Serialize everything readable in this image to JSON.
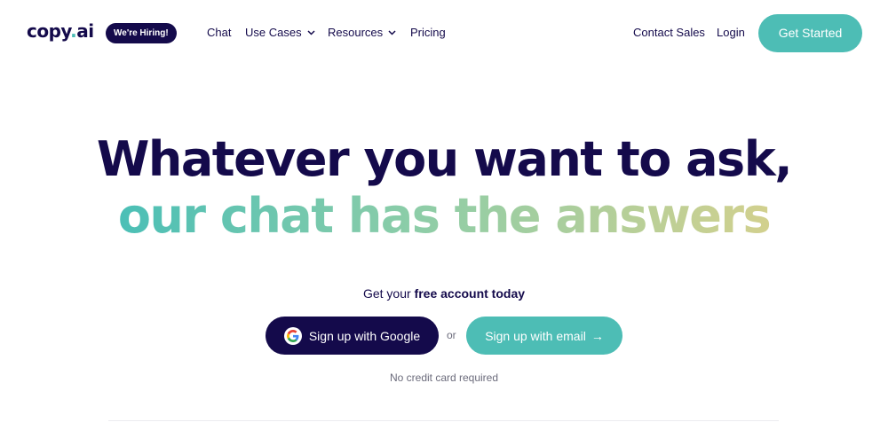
{
  "header": {
    "logo_main": "copy",
    "logo_dot": ".",
    "logo_suffix": "ai",
    "hiring_badge": "We're Hiring!",
    "nav": {
      "chat": "Chat",
      "use_cases": "Use Cases",
      "resources": "Resources",
      "pricing": "Pricing",
      "contact_sales": "Contact Sales",
      "login": "Login"
    },
    "cta": "Get Started"
  },
  "hero": {
    "line1": "Whatever you want to ask,",
    "line2": "our chat has the answers",
    "sub_prefix": "Get your ",
    "sub_bold": "free account today",
    "google_button": "Sign up with Google",
    "or": "or",
    "email_button": "Sign up with email",
    "email_arrow": "→",
    "note": "No credit card required"
  },
  "colors": {
    "navy": "#140a4b",
    "teal": "#4dbdb5",
    "gradient_end": "#d2d08e"
  }
}
